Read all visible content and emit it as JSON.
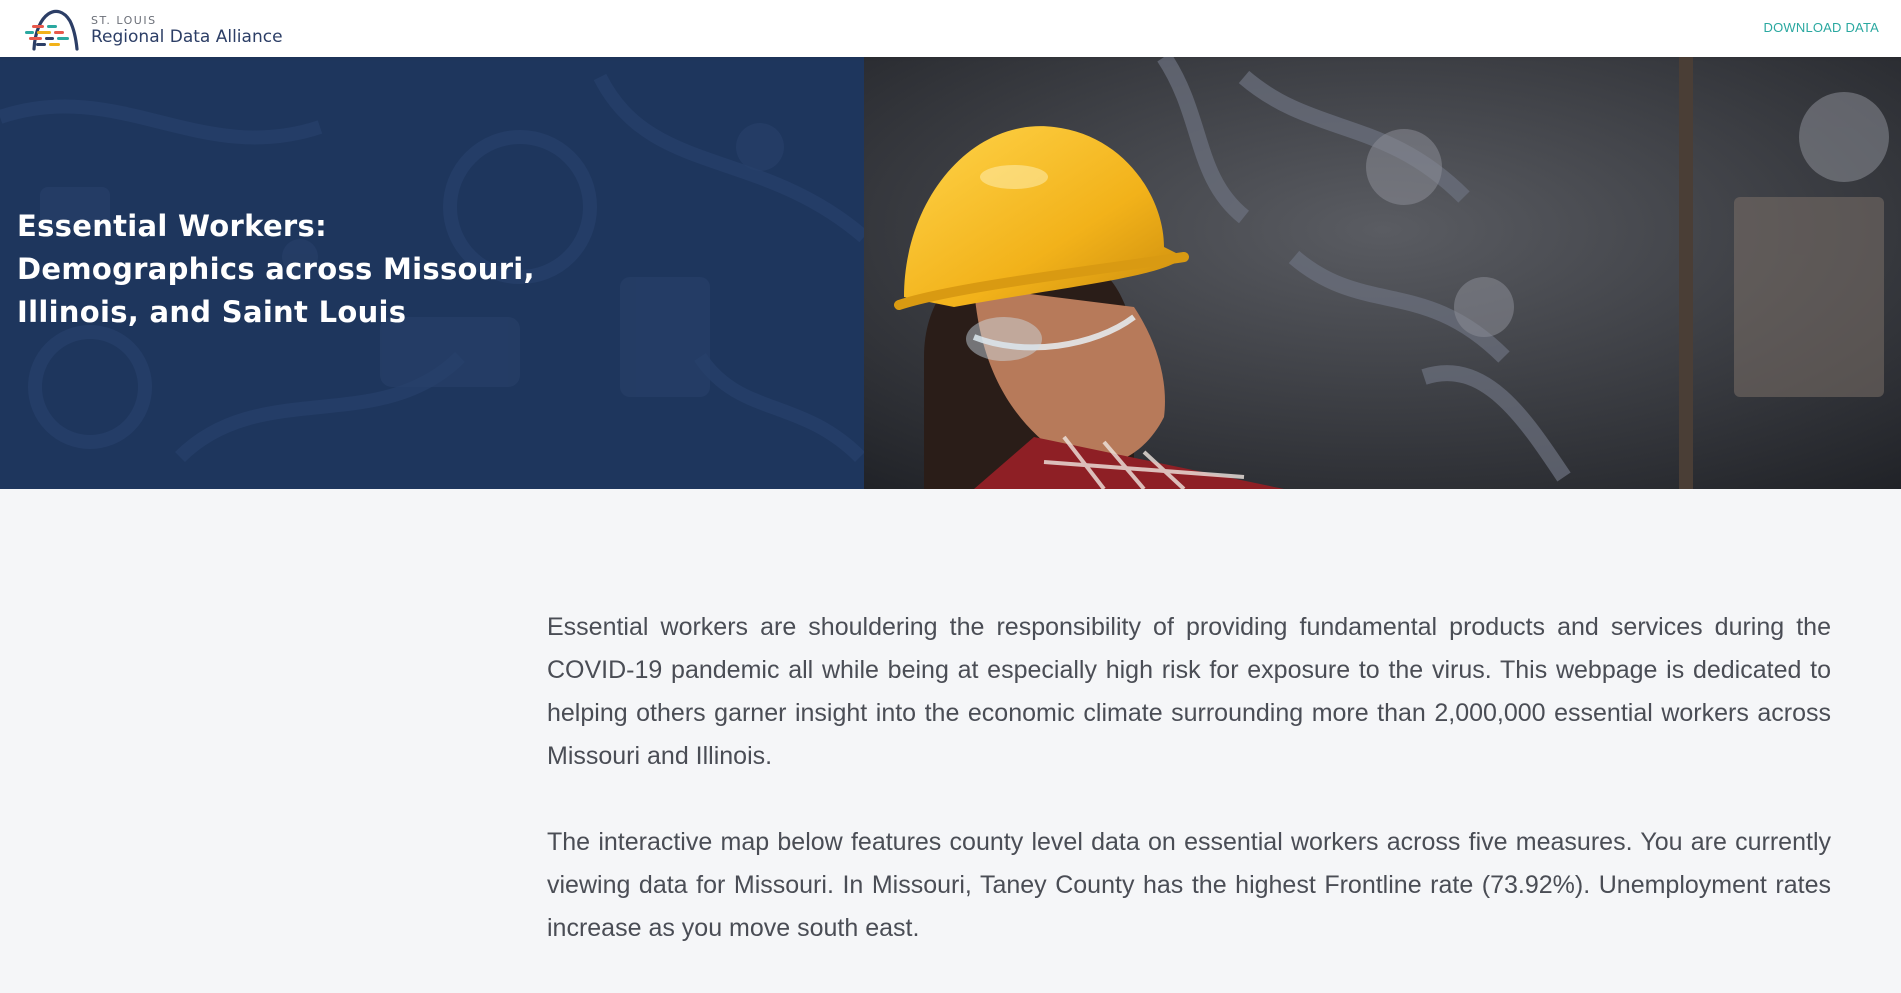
{
  "header": {
    "logo_small": "ST. LOUIS",
    "logo_name": "Regional Data Alliance",
    "download_label": "DOWNLOAD DATA"
  },
  "hero": {
    "title_line1": "Essential Workers:",
    "title_line2": "Demographics across Missouri,",
    "title_line3": "Illinois, and Saint Louis"
  },
  "intro": {
    "paragraph1": "Essential workers are shouldering the responsibility of providing fundamental products and services during the COVID-19 pandemic all while being at especially high risk for exposure to the virus. This webpage is dedicated to helping others garner insight into the economic climate surrounding more than 2,000,000 essential workers across Missouri and Illinois.",
    "paragraph2": "The interactive map below features county level data on essential workers across five measures. You are currently viewing data for Missouri. In Missouri, Taney County has the highest Frontline rate (73.92%). Unemployment rates increase as you move south east."
  },
  "colors": {
    "hero_blue": "#1e365d",
    "accent_teal": "#2aa8a0",
    "text_gray": "#4a4d55",
    "page_bg": "#f5f6f8",
    "hardhat_yellow": "#f2b21a"
  },
  "icons": {
    "logo": "arch-logo-icon"
  }
}
